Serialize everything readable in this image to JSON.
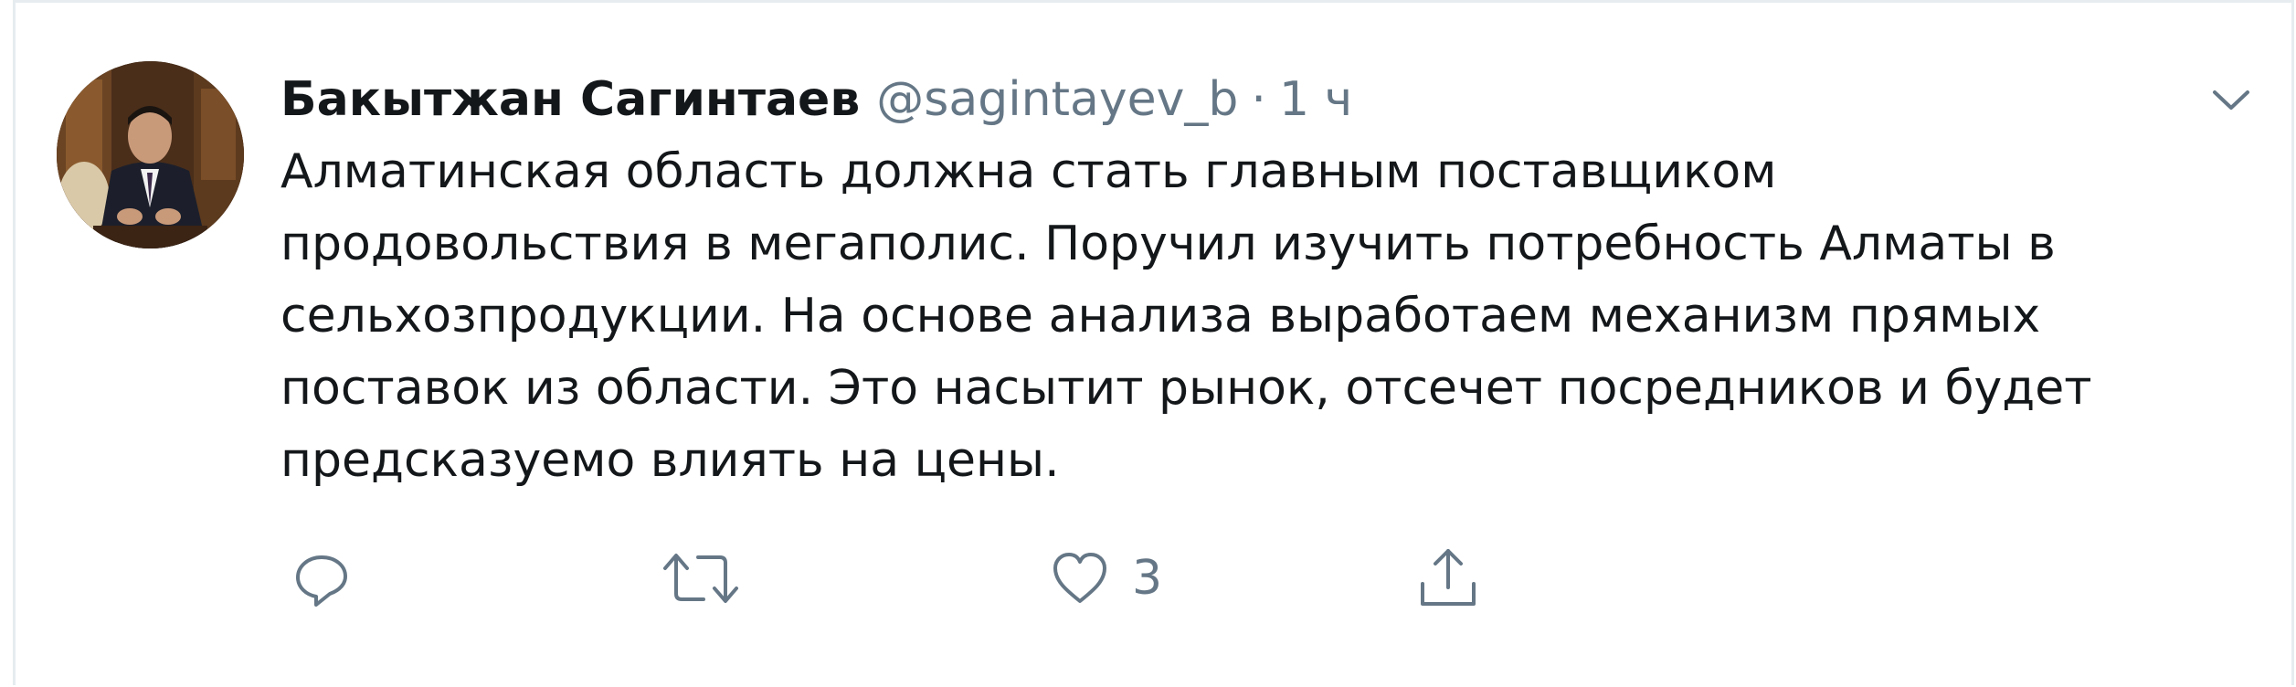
{
  "tweet": {
    "author": {
      "display_name": "Бакытжан Сагинтаев",
      "handle": "@sagintayev_b"
    },
    "separator": "·",
    "time": "1 ч",
    "text_lines": [
      "Алматинская область должна стать главным поставщиком",
      "продовольствия в мегаполис. Поручил изучить потребность Алматы в",
      "сельхозпродукции. На основе анализа выработаем механизм прямых",
      "поставок из области. Это насытит рынок, отсечет посредников и будет",
      "предсказуемо влиять на цены."
    ],
    "actions": {
      "reply": {
        "icon": "reply-icon",
        "count": ""
      },
      "retweet": {
        "icon": "retweet-icon",
        "count": ""
      },
      "like": {
        "icon": "heart-icon",
        "count": "3"
      },
      "share": {
        "icon": "share-icon",
        "count": ""
      }
    },
    "menu_icon": "chevron-down-icon"
  },
  "colors": {
    "text_primary": "#14171a",
    "text_secondary": "#657786",
    "border": "#e6ecf0"
  }
}
